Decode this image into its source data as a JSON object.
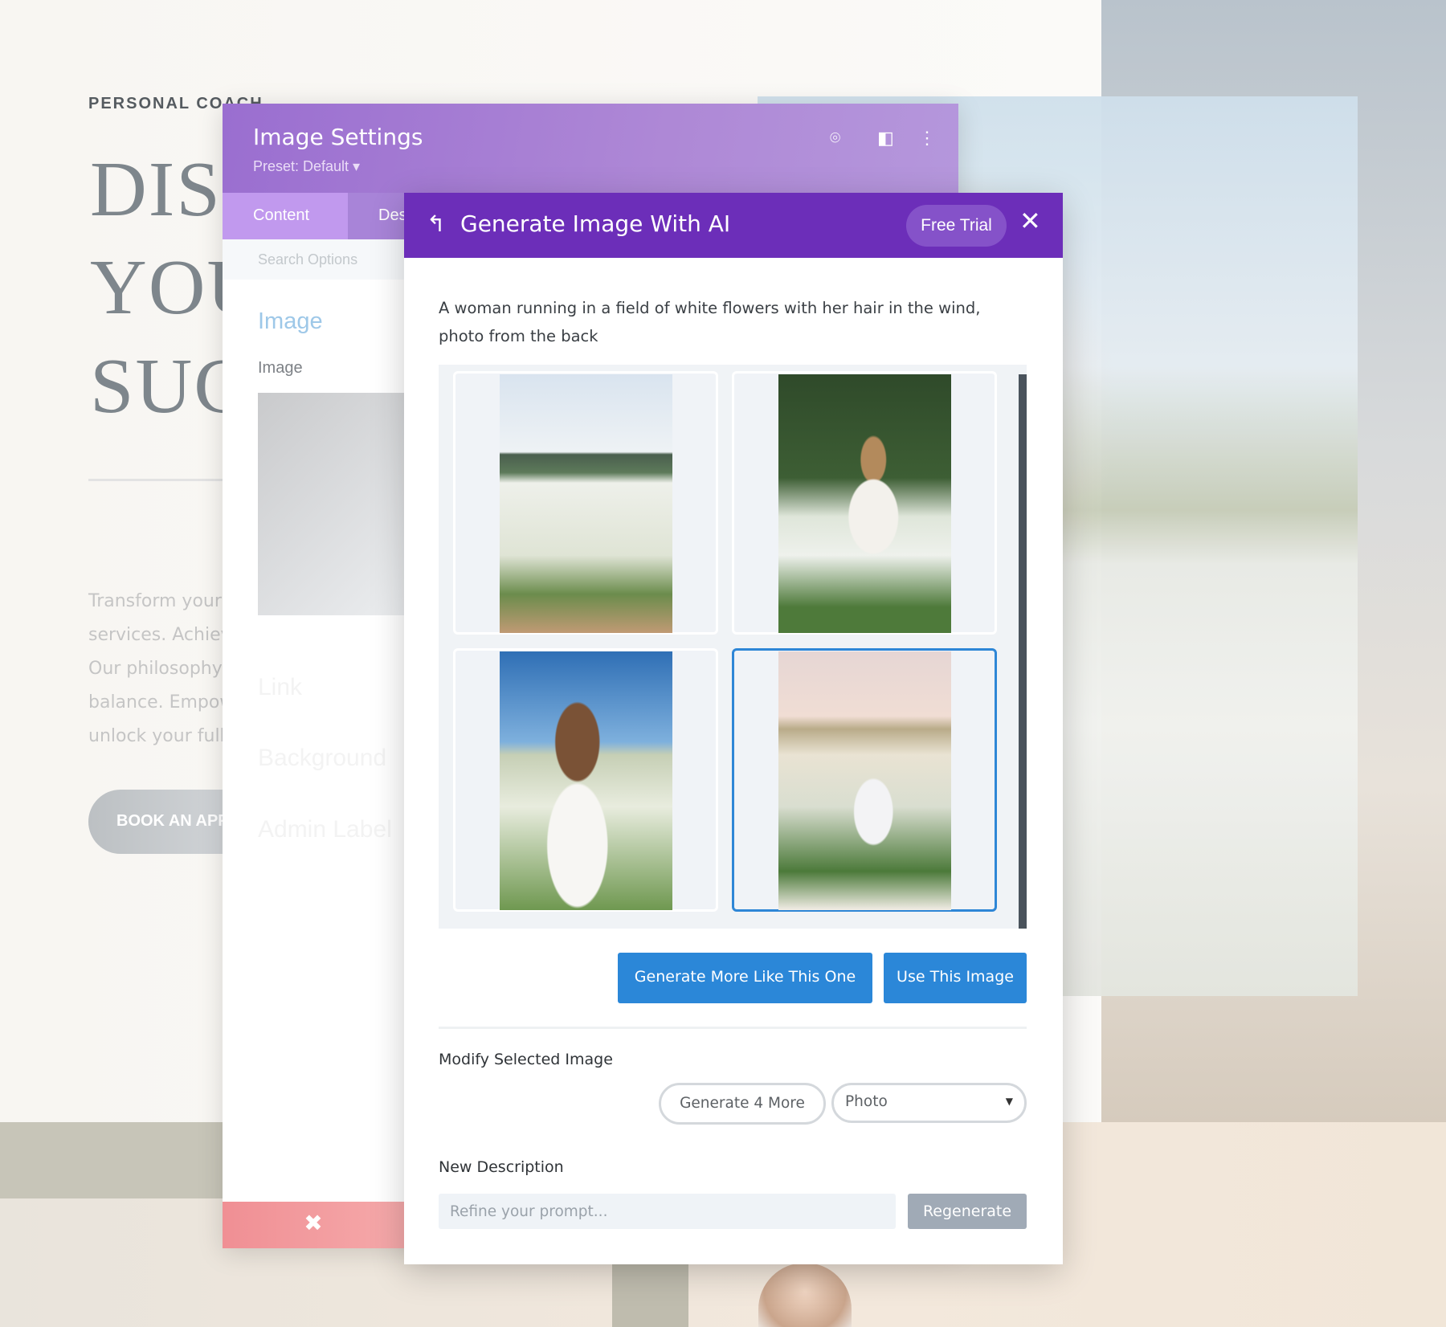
{
  "background": {
    "kicker": "PERSONAL COACH",
    "hero_lines": [
      "DISCOVER",
      "YOUR",
      "SUCCESS"
    ],
    "paragraph": [
      "Transform your",
      "services. Achieve",
      "Our philosophy",
      "balance. Empower",
      "unlock your full"
    ],
    "cta": "BOOK AN APPOINTMENT"
  },
  "settings": {
    "title": "Image Settings",
    "preset": "Preset: Default ▾",
    "icons": [
      "focus-icon",
      "split-view-icon",
      "more-vertical-icon"
    ],
    "tabs": [
      "Content",
      "Design"
    ],
    "search_placeholder": "Search Options",
    "section": "Image",
    "field_label": "Image",
    "ghost_sections": [
      "Link",
      "Background",
      "Admin Label"
    ],
    "close_label": "✖"
  },
  "modal": {
    "back_icon": "↰",
    "title": "Generate Image With AI",
    "badge": "Free Trial",
    "close": "✕",
    "prompt": "A woman running in a field of white flowers with her hair in the wind, photo from the back",
    "selected_index": 3,
    "generate_more": "Generate More Like This One",
    "use_image": "Use This Image",
    "modify_label": "Modify Selected Image",
    "generate_4": "Generate 4 More",
    "style_value": "Photo",
    "new_desc_label": "New Description",
    "refine_placeholder": "Refine your prompt...",
    "regenerate": "Regenerate",
    "accent": "#6c2eb9",
    "button_color": "#2b87d8"
  }
}
